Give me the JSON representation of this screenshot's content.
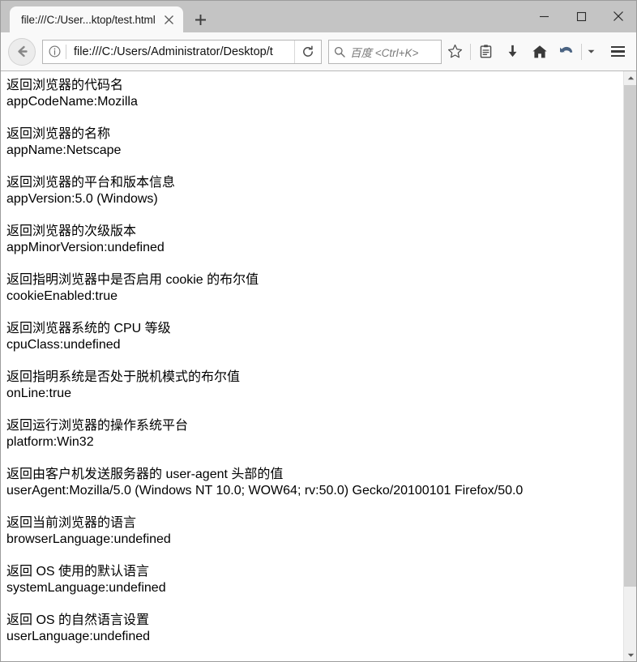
{
  "window": {
    "controls": {
      "minimize": "—",
      "maximize": "□",
      "close": "✕"
    }
  },
  "tabbar": {
    "tab_title": "file:///C:/User...ktop/test.html",
    "close_label": "✕",
    "newtab_label": "+"
  },
  "toolbar": {
    "url_value": "file:///C:/Users/Administrator/Desktop/t",
    "search_placeholder": "百度 <Ctrl+K>",
    "icons": {
      "back": "back-arrow-icon",
      "identity": "info-icon",
      "reload": "reload-icon",
      "search": "search-icon",
      "bookmark": "star-icon",
      "library": "library-icon",
      "downloads": "download-arrow-icon",
      "home": "home-icon",
      "history": "history-back-arrow-icon",
      "overflow": "chevron-down-icon",
      "menu": "hamburger-menu-icon"
    }
  },
  "page": {
    "blocks": [
      {
        "desc": "返回浏览器的代码名",
        "value": "appCodeName:Mozilla"
      },
      {
        "desc": "返回浏览器的名称",
        "value": "appName:Netscape"
      },
      {
        "desc": "返回浏览器的平台和版本信息",
        "value": "appVersion:5.0 (Windows)"
      },
      {
        "desc": "返回浏览器的次级版本",
        "value": "appMinorVersion:undefined"
      },
      {
        "desc": "返回指明浏览器中是否启用 cookie 的布尔值",
        "value": "cookieEnabled:true"
      },
      {
        "desc": "返回浏览器系统的 CPU 等级",
        "value": "cpuClass:undefined"
      },
      {
        "desc": "返回指明系统是否处于脱机模式的布尔值",
        "value": "onLine:true"
      },
      {
        "desc": "返回运行浏览器的操作系统平台",
        "value": "platform:Win32"
      },
      {
        "desc": "返回由客户机发送服务器的 user-agent 头部的值",
        "value": "userAgent:Mozilla/5.0 (Windows NT 10.0; WOW64; rv:50.0) Gecko/20100101 Firefox/50.0"
      },
      {
        "desc": "返回当前浏览器的语言",
        "value": "browserLanguage:undefined"
      },
      {
        "desc": "返回 OS 使用的默认语言",
        "value": "systemLanguage:undefined"
      },
      {
        "desc": "返回 OS 的自然语言设置",
        "value": "userLanguage:undefined"
      }
    ]
  },
  "scrollbar": {
    "up_arrow": "scroll-up-arrow-icon",
    "down_arrow": "scroll-down-arrow-icon"
  },
  "colors": {
    "chrome_gray": "#c4c4c4",
    "toolbar_bg": "#f9f9f9",
    "content_bg": "#ffffff",
    "text": "#000000",
    "history_blue": "#4a6382"
  }
}
